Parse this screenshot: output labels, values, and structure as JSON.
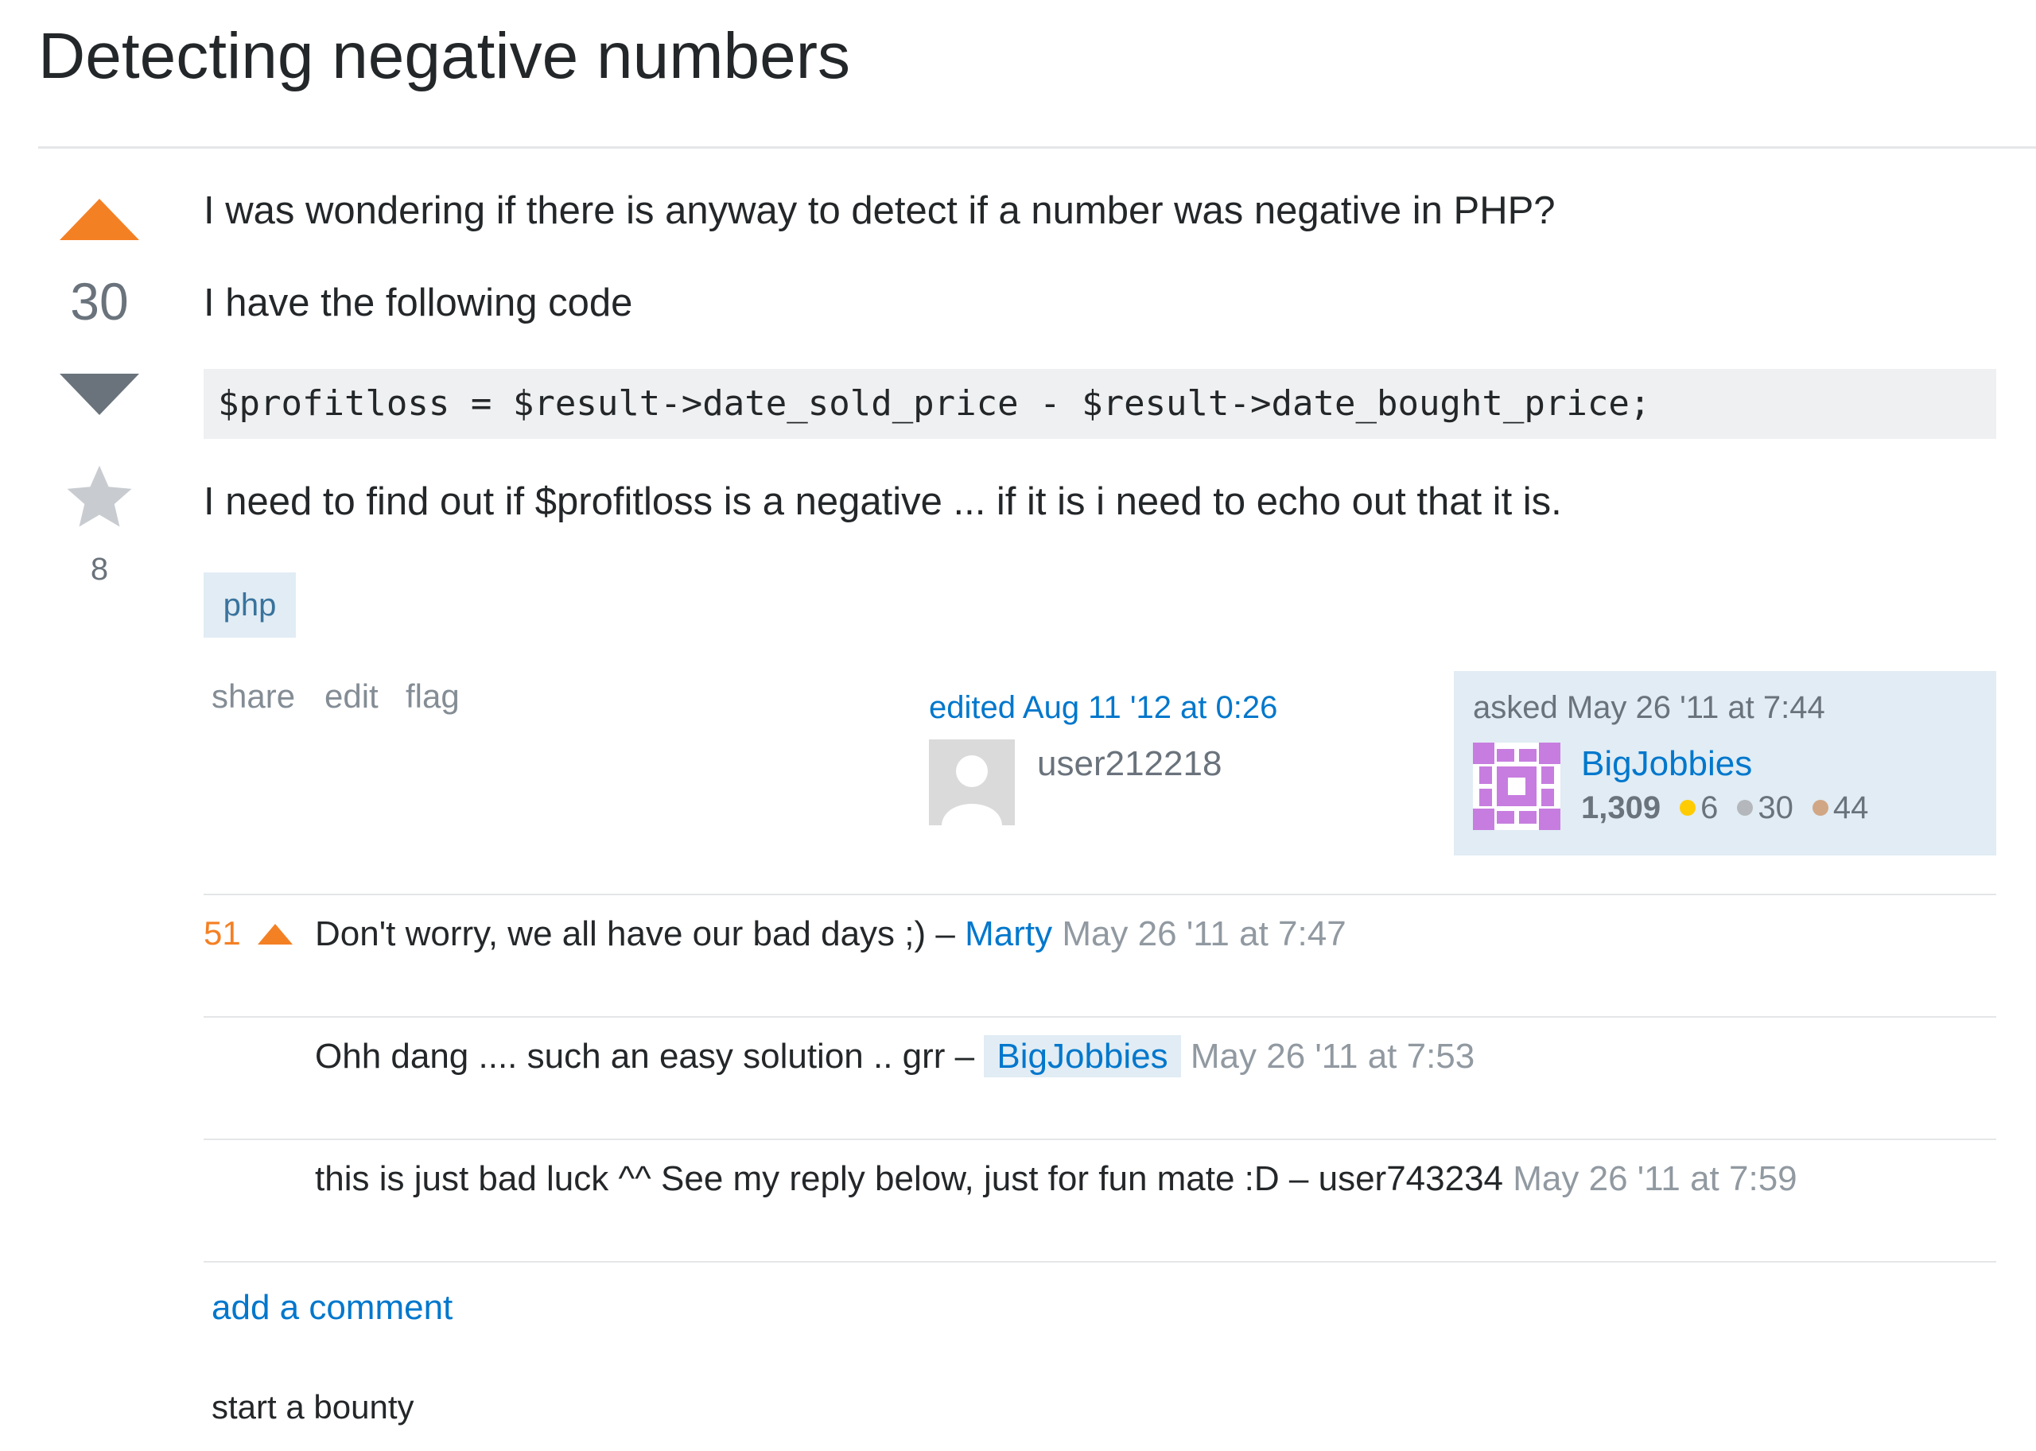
{
  "question": {
    "title": "Detecting negative numbers",
    "vote_count": "30",
    "favorite_count": "8",
    "body": {
      "p1": "I was wondering if there is anyway to detect if a number was negative in PHP?",
      "p2": "I have the following code",
      "code": "$profitloss = $result->date_sold_price - $result->date_bought_price;",
      "p3": "I need to find out if $profitloss is a negative ... if it is i need to echo out that it is."
    },
    "tags": [
      "php"
    ],
    "menu": {
      "share": "share",
      "edit": "edit",
      "flag": "flag"
    },
    "edited": {
      "label": "edited Aug 11 '12 at 0:26",
      "user": "user212218"
    },
    "owner": {
      "asked_label": "asked May 26 '11 at 7:44",
      "name": "BigJobbies",
      "reputation": "1,309",
      "gold": "6",
      "silver": "30",
      "bronze": "44"
    }
  },
  "comments": [
    {
      "score": "51",
      "text": "Don't worry, we all have our bad days ;) – ",
      "user": "Marty",
      "date": "May 26 '11 at 7:47"
    },
    {
      "score": "",
      "text": "Ohh dang .... such an easy solution .. grr – ",
      "user": "BigJobbies",
      "date": "May 26 '11 at 7:53"
    },
    {
      "score": "",
      "text": "this is just bad luck ^^ See my reply below, just for fun mate :D – ",
      "user": "user743234",
      "date": "May 26 '11 at 7:59"
    }
  ],
  "actions": {
    "add_comment": "add a comment",
    "start_bounty": "start a bounty"
  },
  "colors": {
    "accent_orange": "#f48024",
    "link_blue": "#0077cc",
    "tag_bg": "#e1ecf4"
  },
  "icons": [
    "upvote-icon",
    "downvote-icon",
    "favorite-star-icon",
    "default-avatar-icon",
    "identicon-avatar",
    "badge-dot-icon"
  ]
}
